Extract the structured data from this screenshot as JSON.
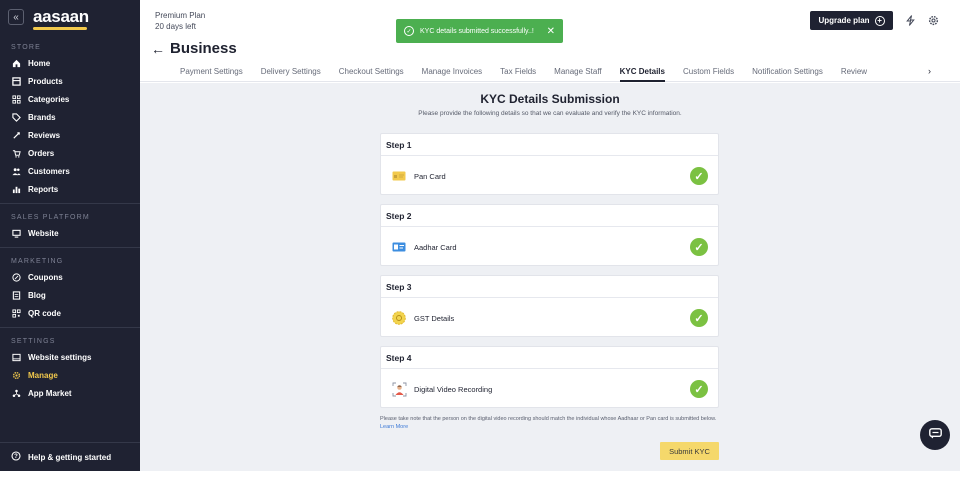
{
  "app": {
    "logo_text": "aasaan",
    "brand_accent": "#f2c94c",
    "sidebar_bg": "#1f2232"
  },
  "sidebar": {
    "collapse_icon": "chevrons-left-icon",
    "sections": [
      {
        "title": "STORE",
        "items": [
          {
            "label": "Home",
            "icon": "home-icon"
          },
          {
            "label": "Products",
            "icon": "box-icon"
          },
          {
            "label": "Categories",
            "icon": "grid-icon"
          },
          {
            "label": "Brands",
            "icon": "tag-icon"
          },
          {
            "label": "Reviews",
            "icon": "review-icon"
          },
          {
            "label": "Orders",
            "icon": "cart-icon"
          },
          {
            "label": "Customers",
            "icon": "users-icon"
          },
          {
            "label": "Reports",
            "icon": "bar-chart-icon"
          }
        ]
      },
      {
        "title": "SALES PLATFORM",
        "items": [
          {
            "label": "Website",
            "icon": "monitor-icon"
          }
        ]
      },
      {
        "title": "MARKETING",
        "items": [
          {
            "label": "Coupons",
            "icon": "percent-icon"
          },
          {
            "label": "Blog",
            "icon": "document-icon"
          },
          {
            "label": "QR code",
            "icon": "qr-icon"
          }
        ]
      },
      {
        "title": "SETTINGS",
        "items": [
          {
            "label": "Website settings",
            "icon": "browser-icon"
          },
          {
            "label": "Manage",
            "icon": "gear-icon",
            "active": true
          },
          {
            "label": "App Market",
            "icon": "apps-icon"
          }
        ]
      }
    ],
    "help_label": "Help & getting started"
  },
  "header": {
    "plan_name": "Premium Plan",
    "plan_days": "20 days left",
    "page_title": "Business",
    "upgrade_label": "Upgrade plan",
    "toast_text": "KYC details submitted successfully..!",
    "toast_color": "#4caf50",
    "tabs": [
      "Payment Settings",
      "Delivery Settings",
      "Checkout Settings",
      "Manage Invoices",
      "Tax Fields",
      "Manage Staff",
      "KYC Details",
      "Custom Fields",
      "Notification Settings",
      "Review"
    ],
    "active_tab": "KYC Details"
  },
  "main": {
    "title": "KYC Details Submission",
    "subtitle": "Please provide the following details so that we can evaluate and verify the KYC information.",
    "steps": [
      {
        "heading": "Step 1",
        "label": "Pan Card",
        "icon": "pan-card-icon",
        "status": "complete"
      },
      {
        "heading": "Step 2",
        "label": "Aadhar Card",
        "icon": "aadhar-card-icon",
        "status": "complete"
      },
      {
        "heading": "Step 3",
        "label": "GST Details",
        "icon": "gst-badge-icon",
        "status": "complete"
      },
      {
        "heading": "Step 4",
        "label": "Digital Video Recording",
        "icon": "video-person-icon",
        "status": "complete"
      }
    ],
    "note_text": "Please take note that the person on the digital video recording should match the individual whose Aadhaar or Pan card is submitted below.",
    "note_link": "Learn More",
    "submit_label": "Submit KYC",
    "check_color": "#7bc142"
  }
}
